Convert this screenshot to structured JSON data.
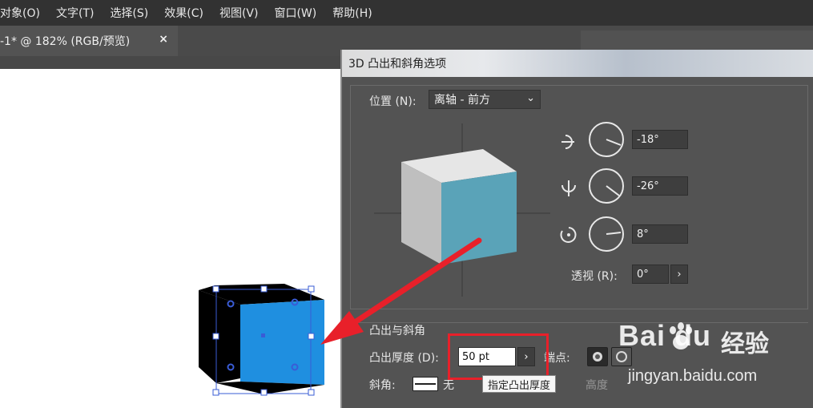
{
  "menu": {
    "items": [
      {
        "label": "对象(O)"
      },
      {
        "label": "文字(T)"
      },
      {
        "label": "选择(S)"
      },
      {
        "label": "效果(C)"
      },
      {
        "label": "视图(V)"
      },
      {
        "label": "窗口(W)"
      },
      {
        "label": "帮助(H)"
      }
    ]
  },
  "document_tab": {
    "title": "-1* @ 182% (RGB/预览)",
    "close_label": "×"
  },
  "dialog": {
    "title": "3D 凸出和斜角选项",
    "position_label": "位置 (N):",
    "position_value": "离轴 - 前方",
    "rotation_x": "-18°",
    "rotation_y": "-26°",
    "rotation_z": "8°",
    "perspective_label": "透视 (R):",
    "perspective_value": "0°",
    "stepper_glyph": "›",
    "extrude_section_label": "凸出与斜角",
    "extrude_depth_label": "凸出厚度 (D):",
    "extrude_depth_value": "50 pt",
    "cap_label": "端点:",
    "bevel_label": "斜角:",
    "bevel_value": "无",
    "height_label": "高度",
    "tooltip": "指定凸出厚度"
  },
  "watermark": {
    "logo": "Bai  du",
    "text": "经验",
    "url": "jingyan.baidu.com"
  },
  "colors": {
    "cube_front": "#5aa3b8",
    "cube_side": "#c8c8c8",
    "selection_front": "#1f8fe0",
    "selection_handle": "#3a5cd6",
    "highlight": "#e8202a",
    "arrow": "#e8202a"
  }
}
